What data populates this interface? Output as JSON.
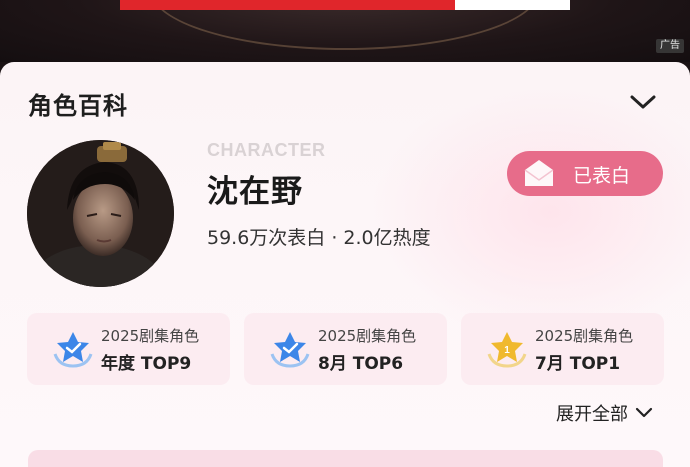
{
  "ad": {
    "label": "广告",
    "strip_text": "",
    "strip_color": "#e0262b"
  },
  "card": {
    "header": "角色百科",
    "collapse_icon": "chevron-down-icon"
  },
  "character": {
    "label": "CHARACTER",
    "name": "沈在野",
    "stats": "59.6万次表白 · 2.0亿热度",
    "confess_button": "已表白",
    "confess_icon": "envelope-icon",
    "accent": "#e76c8a"
  },
  "badges": [
    {
      "line1": "2025剧集角色",
      "line2": "年度 TOP9",
      "icon": "blue-star-medal-icon"
    },
    {
      "line1": "2025剧集角色",
      "line2": "8月 TOP6",
      "icon": "blue-star-medal-icon"
    },
    {
      "line1": "2025剧集角色",
      "line2": "7月 TOP1",
      "icon": "gold-star-medal-icon"
    }
  ],
  "expand_all": "展开全部"
}
